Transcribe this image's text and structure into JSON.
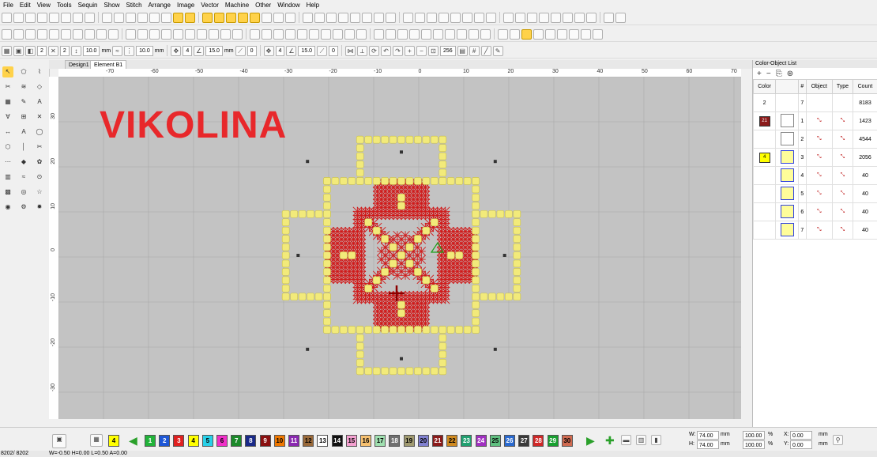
{
  "menu": [
    "File",
    "Edit",
    "View",
    "Tools",
    "Sequin",
    "Show",
    "Stitch",
    "Arrange",
    "Image",
    "Vector",
    "Machine",
    "Other",
    "Window",
    "Help"
  ],
  "toolbar2": {
    "field1": "2",
    "field2": "2",
    "spacing": "10.0",
    "spacing_unit": "mm",
    "spacing2": "10.0",
    "unit": "mm"
  },
  "toolbar3": {
    "val1": "2",
    "val2": "2",
    "len1": "10.0",
    "len2": "10.0",
    "unit": "mm",
    "n1": "4",
    "angle1": "15.0",
    "angle_unit": "mm",
    "zero1": "0",
    "n2": "4",
    "angle2": "15.0",
    "zero2": "0",
    "zoom": "256"
  },
  "tabs": [
    "Design1",
    "Element B1"
  ],
  "canvas": {
    "title_text": "VIKOLINA",
    "title_color": "#e8282b",
    "background": "#c3c3c3",
    "stitch_red": "#d01a1a",
    "stitch_yellow": "#f2ea7a"
  },
  "ruler_top": [
    "-70",
    "-60",
    "-50",
    "-40",
    "-30",
    "-20",
    "-10",
    "0",
    "10",
    "20",
    "30",
    "40",
    "50",
    "60",
    "70"
  ],
  "ruler_left": [
    "30",
    "20",
    "10",
    "0",
    "-10",
    "-20",
    "-30"
  ],
  "panel": {
    "title": "Color-Object List",
    "headers": [
      "Color",
      "#",
      "Object",
      "Type",
      "Count"
    ],
    "summary": {
      "colors": "2",
      "objects": "7",
      "count": "8183"
    },
    "rows": [
      {
        "color": "21",
        "color_hex": "#8b1a1a",
        "num": "1",
        "count": "1423"
      },
      {
        "color": "",
        "color_hex": "",
        "num": "2",
        "count": "4544"
      },
      {
        "color": "4",
        "color_hex": "#ffff00",
        "num": "3",
        "count": "2056"
      },
      {
        "color": "",
        "color_hex": "",
        "num": "4",
        "count": "40"
      },
      {
        "color": "",
        "color_hex": "",
        "num": "5",
        "count": "40"
      },
      {
        "color": "",
        "color_hex": "",
        "num": "6",
        "count": "40"
      },
      {
        "color": "",
        "color_hex": "",
        "num": "7",
        "count": "40"
      }
    ]
  },
  "palette": {
    "current": "4",
    "chips": [
      {
        "n": "1",
        "c": "#22b33a"
      },
      {
        "n": "2",
        "c": "#1e57d6"
      },
      {
        "n": "3",
        "c": "#e02020"
      },
      {
        "n": "4",
        "c": "#ffff00"
      },
      {
        "n": "5",
        "c": "#28d0e8"
      },
      {
        "n": "6",
        "c": "#f030c8"
      },
      {
        "n": "7",
        "c": "#1c8a2a"
      },
      {
        "n": "8",
        "c": "#1a2a88"
      },
      {
        "n": "9",
        "c": "#8a1010"
      },
      {
        "n": "10",
        "c": "#f07800"
      },
      {
        "n": "11",
        "c": "#8a28b0"
      },
      {
        "n": "12",
        "c": "#9a6a3a"
      },
      {
        "n": "13",
        "c": "#ffffff"
      },
      {
        "n": "14",
        "c": "#111111"
      },
      {
        "n": "15",
        "c": "#f4a0d0"
      },
      {
        "n": "16",
        "c": "#f6c070"
      },
      {
        "n": "17",
        "c": "#a0e0b0"
      },
      {
        "n": "18",
        "c": "#707070"
      },
      {
        "n": "19",
        "c": "#a09a70"
      },
      {
        "n": "20",
        "c": "#8080d0"
      },
      {
        "n": "21",
        "c": "#8b1a1a"
      },
      {
        "n": "22",
        "c": "#d08a20"
      },
      {
        "n": "23",
        "c": "#20a070"
      },
      {
        "n": "24",
        "c": "#a030c0"
      },
      {
        "n": "25",
        "c": "#60c080"
      },
      {
        "n": "26",
        "c": "#2a6ad0"
      },
      {
        "n": "27",
        "c": "#3a3a3a"
      },
      {
        "n": "28",
        "c": "#d02828"
      },
      {
        "n": "29",
        "c": "#18a030"
      },
      {
        "n": "30",
        "c": "#d06a50"
      }
    ]
  },
  "dimensions": {
    "w_label": "W:",
    "w": "74.00",
    "h_label": "H:",
    "h": "74.00",
    "unit": "mm",
    "sx": "100.00",
    "sy": "100.00",
    "pct": "%",
    "x_label": "X:",
    "x": "0.00",
    "y_label": "Y:",
    "y": "0.00"
  },
  "status": {
    "left": "8202/ 8202",
    "info": "W=-0.50 H=0.00 L=0.50 A=0.00"
  }
}
